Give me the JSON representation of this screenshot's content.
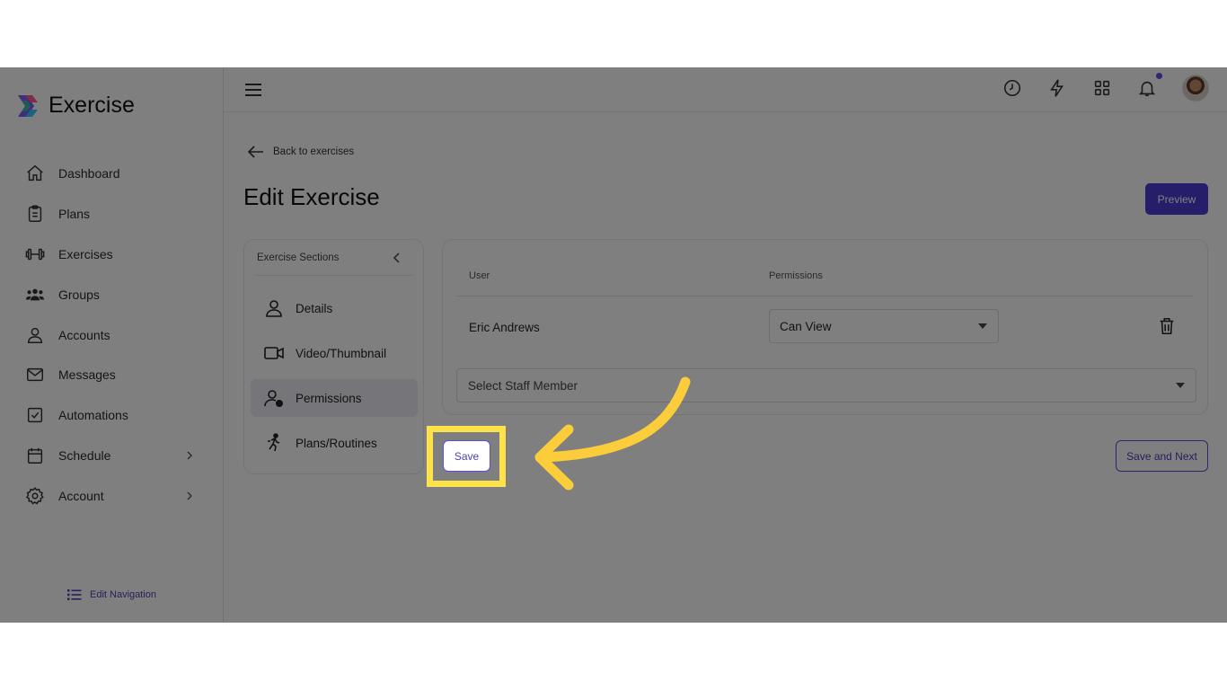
{
  "app": {
    "name": "Exercise"
  },
  "sidebar": {
    "items": [
      {
        "label": "Dashboard",
        "icon": "home-icon"
      },
      {
        "label": "Plans",
        "icon": "clipboard-icon"
      },
      {
        "label": "Exercises",
        "icon": "dumbbell-icon"
      },
      {
        "label": "Groups",
        "icon": "group-icon"
      },
      {
        "label": "Accounts",
        "icon": "user-icon"
      },
      {
        "label": "Messages",
        "icon": "mail-icon"
      },
      {
        "label": "Automations",
        "icon": "checkbox-icon"
      },
      {
        "label": "Schedule",
        "icon": "calendar-icon",
        "has_submenu": true
      },
      {
        "label": "Account",
        "icon": "gear-icon",
        "has_submenu": true
      }
    ],
    "edit_navigation": "Edit Navigation"
  },
  "topbar": {
    "icons": [
      "history-icon",
      "lightning-icon",
      "apps-grid-icon",
      "bell-icon"
    ],
    "notification_dot_color": "#5b4de0"
  },
  "page": {
    "back_link": "Back to exercises",
    "title": "Edit Exercise",
    "preview_button": "Preview"
  },
  "sections": {
    "header": "Exercise Sections",
    "items": [
      {
        "label": "Details",
        "icon": "person-icon"
      },
      {
        "label": "Video/Thumbnail",
        "icon": "video-icon"
      },
      {
        "label": "Permissions",
        "icon": "user-lock-icon",
        "active": true
      },
      {
        "label": "Plans/Routines",
        "icon": "running-icon"
      }
    ]
  },
  "permissions": {
    "columns": {
      "user": "User",
      "permissions": "Permissions"
    },
    "rows": [
      {
        "user": "Eric Andrews",
        "permission": "Can View"
      }
    ],
    "staff_placeholder": "Select Staff Member"
  },
  "actions": {
    "save": "Save",
    "save_next": "Save and Next"
  },
  "colors": {
    "accent": "#4e3dd6",
    "highlight": "#fde24a",
    "arrow": "#fbcd3a"
  }
}
